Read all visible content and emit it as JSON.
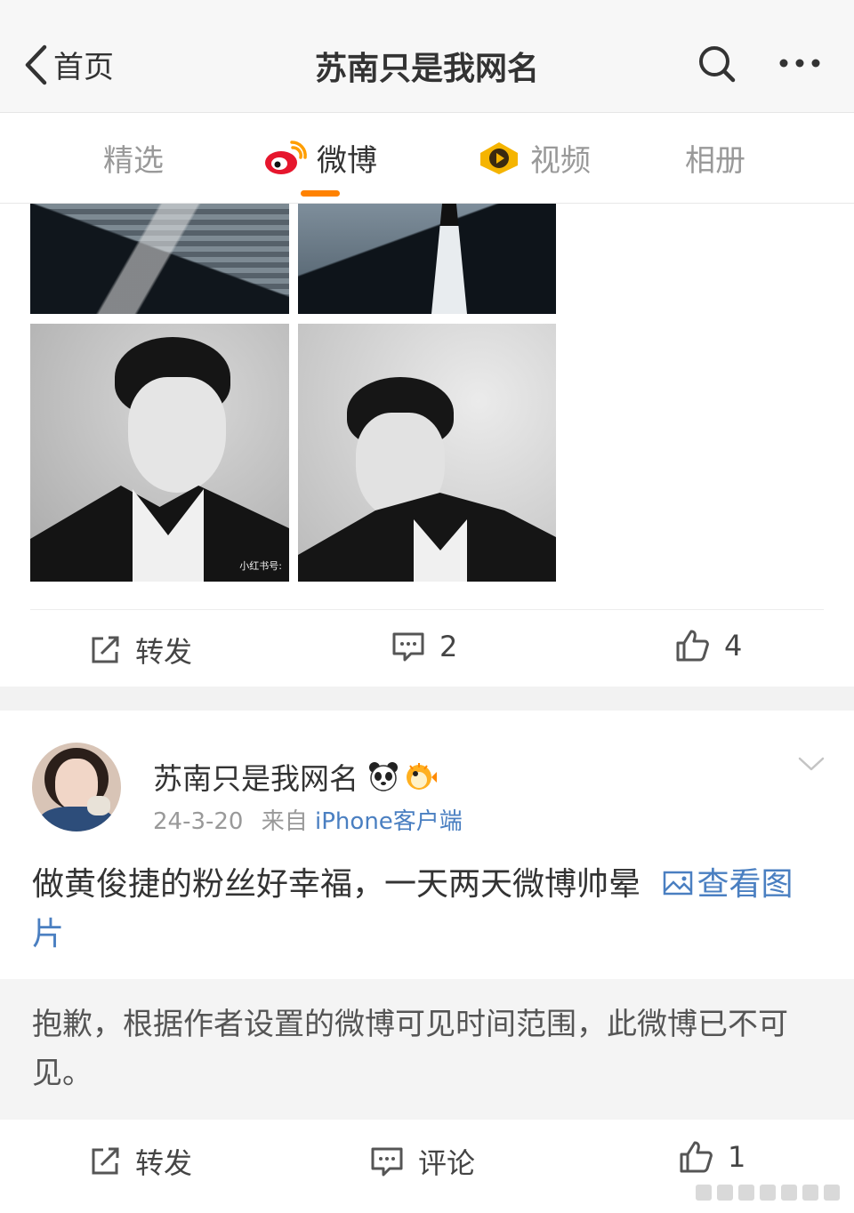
{
  "header": {
    "back_label": "首页",
    "title": "苏南只是我网名"
  },
  "tabs": [
    {
      "label": "精选",
      "icon": null,
      "active": false
    },
    {
      "label": "微博",
      "icon": "weibo-logo-icon",
      "active": true
    },
    {
      "label": "视频",
      "icon": "video-play-icon",
      "active": false
    },
    {
      "label": "相册",
      "icon": null,
      "active": false
    }
  ],
  "post1": {
    "images": [
      {
        "watermark": ""
      },
      {
        "watermark": ""
      },
      {
        "watermark": "小红书号:"
      },
      {
        "watermark": ""
      }
    ],
    "actions": {
      "repost_label": "转发",
      "comment_count": "2",
      "like_count": "4"
    }
  },
  "post2": {
    "username": "苏南只是我网名",
    "date": "24-3-20",
    "source_prefix": "来自",
    "source": "iPhone客户端",
    "content_text": "做黄俊捷的粉丝好幸福，一天两天微博帅晕",
    "view_image_label": "查看图片",
    "notice": "抱歉，根据作者设置的微博可见时间范围，此微博已不可见。",
    "actions": {
      "repost_label": "转发",
      "comment_label": "评论",
      "like_count": "1"
    }
  },
  "colors": {
    "accent": "#ff8200",
    "link": "#4a7fc1",
    "header_bg": "#f7f7f7",
    "page_bg": "#f2f2f2"
  }
}
